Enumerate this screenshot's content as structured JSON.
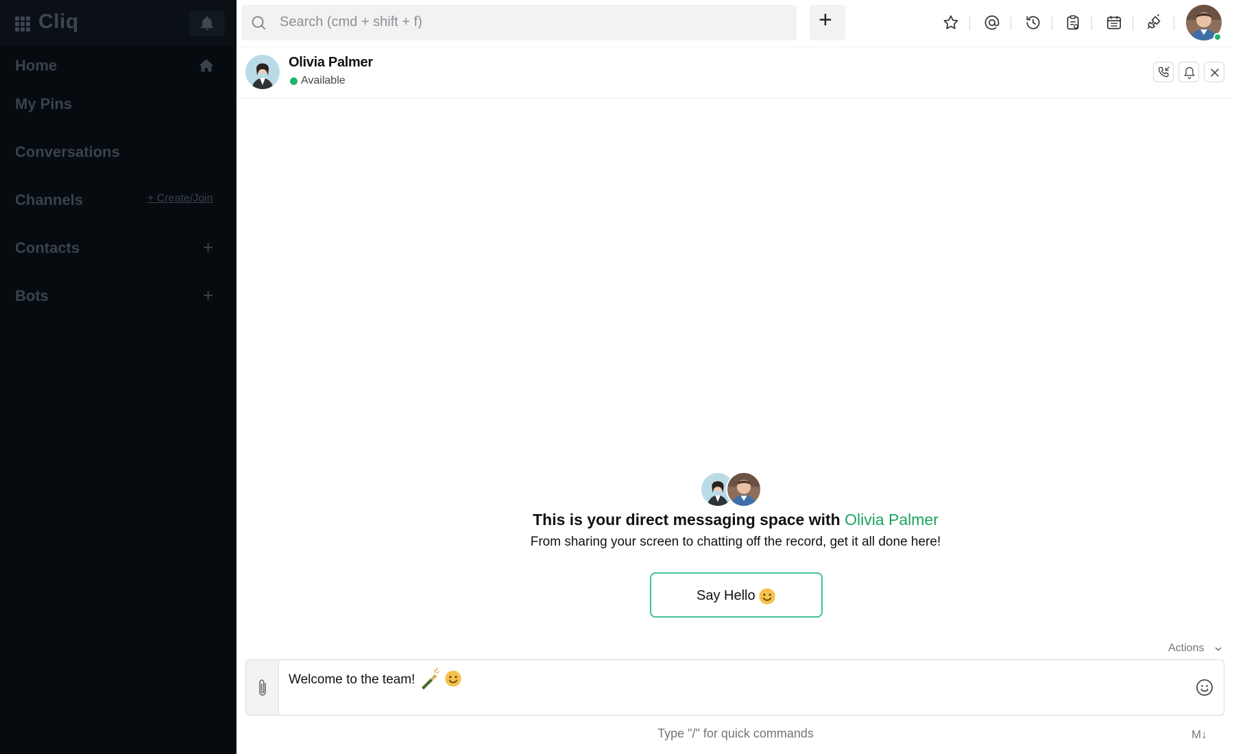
{
  "app": {
    "name": "Cliq"
  },
  "sidebar": {
    "items": [
      {
        "label": "Home"
      },
      {
        "label": "My Pins"
      },
      {
        "label": "Conversations"
      },
      {
        "label": "Channels",
        "action": "+ Create/Join"
      },
      {
        "label": "Contacts"
      },
      {
        "label": "Bots"
      }
    ]
  },
  "topbar": {
    "search_placeholder": "Search (cmd + shift + f)",
    "icons": [
      "star-icon",
      "mention-icon",
      "history-icon",
      "clipboard-icon",
      "calendar-icon",
      "integration-icon"
    ]
  },
  "chat": {
    "contact_name": "Olivia Palmer",
    "status": "Available",
    "status_color": "#21b36b"
  },
  "welcome": {
    "title_prefix": "This is your direct messaging space with ",
    "title_name": "Olivia Palmer",
    "subtitle": "From sharing your screen to chatting off the record, get it all done here!",
    "say_hello_label": "Say Hello"
  },
  "composer": {
    "actions_label": "Actions",
    "message_text": "Welcome to the team!",
    "hint": "Type \"/\" for quick commands",
    "markdown_badge": "M↓"
  },
  "colors": {
    "sidebar_bg": "#060b10",
    "accent_green": "#1ba45c",
    "button_border": "#3ec48e"
  }
}
